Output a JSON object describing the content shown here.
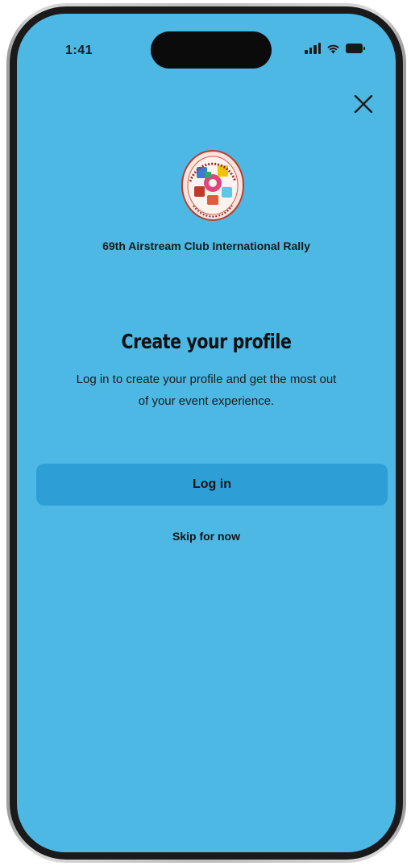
{
  "status_bar": {
    "time": "1:41",
    "icons": [
      "signal-icon",
      "wifi-icon",
      "battery-icon"
    ]
  },
  "close": {
    "icon": "close-icon"
  },
  "event": {
    "logo": "event-logo",
    "name": "69th Airstream Club International Rally"
  },
  "profile": {
    "title": "Create your profile",
    "subtitle": "Log in to create your profile and get the most out of your event experience."
  },
  "actions": {
    "login_label": "Log in",
    "skip_label": "Skip for now"
  },
  "colors": {
    "screen_background": "#4db8e3",
    "button_background": "#2e9fd6",
    "text": "#1a1a1a"
  }
}
